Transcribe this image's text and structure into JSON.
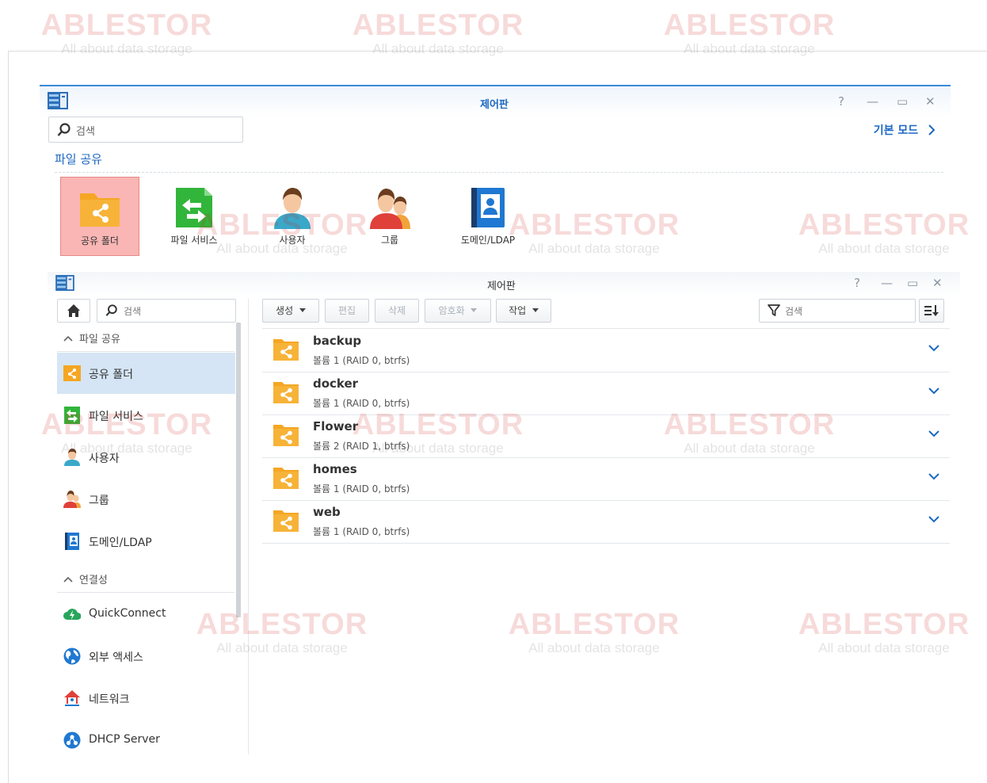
{
  "watermark": {
    "brand": "ABLESTOR",
    "tagline": "All about data storage"
  },
  "colors": {
    "accent": "#1d68c2",
    "folder": "#f5a623",
    "selected_tile": "#f9b6b4",
    "selected_item": "#d5e5f5"
  },
  "top_window": {
    "title": "제어판",
    "controls": {
      "help": "?",
      "minimize": "—",
      "maximize": "▭",
      "close": "✕"
    },
    "search_placeholder": "검색",
    "mode_link": "기본 모드",
    "section": "파일 공유",
    "tiles": [
      {
        "label": "공유 폴더",
        "icon": "shared-folder-icon",
        "selected": true
      },
      {
        "label": "파일 서비스",
        "icon": "file-services-icon"
      },
      {
        "label": "사용자",
        "icon": "user-icon"
      },
      {
        "label": "그룹",
        "icon": "group-icon"
      },
      {
        "label": "도메인/LDAP",
        "icon": "domain-ldap-icon"
      }
    ]
  },
  "main_window": {
    "title": "제어판",
    "controls": {
      "help": "?",
      "minimize": "—",
      "maximize": "▭",
      "close": "✕"
    },
    "sidebar": {
      "search_placeholder": "검색",
      "groups": [
        {
          "label": "파일 공유"
        },
        {
          "label": "연결성"
        }
      ],
      "items": [
        {
          "label": "공유 폴더",
          "icon": "shared-folder-icon",
          "selected": true
        },
        {
          "label": "파일 서비스",
          "icon": "file-services-icon"
        },
        {
          "label": "사용자",
          "icon": "user-icon"
        },
        {
          "label": "그룹",
          "icon": "group-icon"
        },
        {
          "label": "도메인/LDAP",
          "icon": "domain-ldap-icon"
        },
        {
          "label": "QuickConnect",
          "icon": "quickconnect-icon"
        },
        {
          "label": "외부 액세스",
          "icon": "external-access-icon"
        },
        {
          "label": "네트워크",
          "icon": "network-icon"
        },
        {
          "label": "DHCP Server",
          "icon": "dhcp-server-icon"
        }
      ]
    },
    "toolbar": {
      "create": "생성",
      "edit": "편집",
      "delete": "삭제",
      "encrypt": "암호화",
      "action": "작업",
      "filter_placeholder": "검색"
    },
    "folders": [
      {
        "name": "backup",
        "volume": "볼륨 1 (RAID 0, btrfs)"
      },
      {
        "name": "docker",
        "volume": "볼륨 1 (RAID 0, btrfs)"
      },
      {
        "name": "Flower",
        "volume": "볼륨 2 (RAID 1, btrfs)"
      },
      {
        "name": "homes",
        "volume": "볼륨 1 (RAID 0, btrfs)"
      },
      {
        "name": "web",
        "volume": "볼륨 1 (RAID 0, btrfs)"
      }
    ]
  }
}
